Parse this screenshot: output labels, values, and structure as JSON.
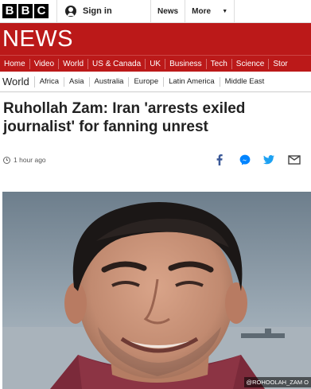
{
  "logo": {
    "letters": [
      "B",
      "B",
      "C"
    ]
  },
  "account": {
    "sign_in_label": "Sign in",
    "icon": "user-icon"
  },
  "top_nav": {
    "news_label": "News",
    "more_label": "More",
    "more_icon": "chevron-down-icon"
  },
  "banner": {
    "title": "NEWS",
    "color": "#bb1919"
  },
  "section_nav": {
    "items": [
      "Home",
      "Video",
      "World",
      "US & Canada",
      "UK",
      "Business",
      "Tech",
      "Science",
      "Stor"
    ],
    "active": "World"
  },
  "sub_nav": {
    "section": "World",
    "items": [
      "Africa",
      "Asia",
      "Australia",
      "Europe",
      "Latin America",
      "Middle East"
    ],
    "current": "Middle East"
  },
  "article": {
    "headline": "Ruhollah Zam: Iran 'arrests exiled journalist' for fanning unrest",
    "timestamp": "1 hour ago",
    "image_credit": "@ROHOOLAH_ZAM O"
  },
  "share_icons": [
    "facebook-icon",
    "messenger-icon",
    "twitter-icon",
    "email-icon"
  ],
  "colors": {
    "bbc_red": "#bb1919",
    "facebook": "#3b5998",
    "messenger": "#0084ff",
    "twitter": "#1da1f2"
  }
}
